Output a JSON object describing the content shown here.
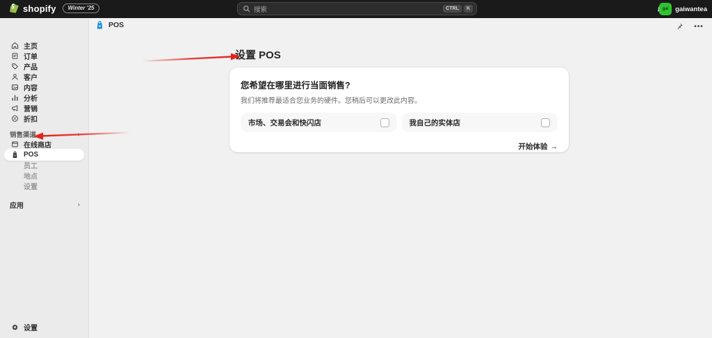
{
  "topbar": {
    "logo_text": "shopify",
    "version_badge": "Winter '25",
    "search": {
      "placeholder": "搜索",
      "shortcut": [
        "CTRL",
        "K"
      ]
    },
    "user": {
      "avatar_initials": "gai",
      "name": "gaiwantea"
    }
  },
  "sidebar": {
    "nav": [
      {
        "label": "主页",
        "icon": "home-icon"
      },
      {
        "label": "订单",
        "icon": "orders-icon"
      },
      {
        "label": "产品",
        "icon": "products-icon"
      },
      {
        "label": "客户",
        "icon": "customers-icon"
      },
      {
        "label": "内容",
        "icon": "content-icon"
      },
      {
        "label": "分析",
        "icon": "analytics-icon"
      },
      {
        "label": "营销",
        "icon": "marketing-icon"
      },
      {
        "label": "折扣",
        "icon": "discounts-icon"
      }
    ],
    "sales_channels": {
      "section_label": "销售渠道",
      "items": [
        {
          "label": "在线商店",
          "icon": "online-store-icon",
          "selected": false
        },
        {
          "label": "POS",
          "icon": "pos-bag-icon",
          "selected": true
        }
      ],
      "subitems": [
        "员工",
        "地点",
        "设置"
      ]
    },
    "apps_section_label": "应用",
    "settings_label": "设置"
  },
  "content_header": {
    "title": "POS"
  },
  "main": {
    "page_title": "设置 POS",
    "card": {
      "heading": "您希望在哪里进行当面销售?",
      "description": "我们将推荐最适合您业务的硬件。您稍后可以更改此内容。",
      "options": [
        {
          "label": "市场、交易会和快闪店",
          "checked": false
        },
        {
          "label": "我自己的实体店",
          "checked": false
        }
      ],
      "action_label": "开始体验",
      "action_arrow": "→"
    }
  },
  "colors": {
    "topbar_bg": "#1a1a1a",
    "sidebar_bg": "#ebebeb",
    "content_bg": "#f1f1f1",
    "avatar_green": "#2fc32f",
    "shopify_logo_green": "#95bf47",
    "pos_channel_blue": "#1e8fd5",
    "annotation_red": "#e1251b"
  }
}
